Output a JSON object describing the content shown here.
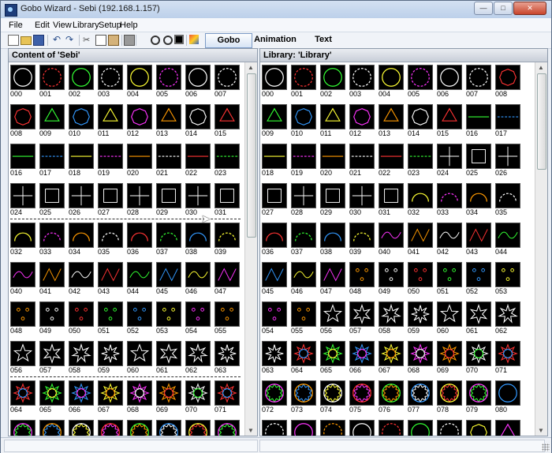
{
  "window": {
    "title": "Gobo Wizard - Sebi (192.168.1.157)",
    "minimize": "—",
    "maximize": "□",
    "close": "✕"
  },
  "menu": [
    "File",
    "Edit",
    "View",
    "Library",
    "Setup",
    "Help"
  ],
  "toolbar_icons": [
    "new-file-icon",
    "open-folder-icon",
    "save-icon",
    "undo-icon",
    "redo-icon",
    "cut-icon",
    "copy-icon",
    "paste-icon",
    "print-icon",
    "grid-icon",
    "zoom-out-icon",
    "zoom-in-icon",
    "fullscreen-icon",
    "color-icon"
  ],
  "tabs": [
    {
      "label": "Gobo",
      "active": true
    },
    {
      "label": "Animation",
      "active": false
    },
    {
      "label": "Text",
      "active": false
    }
  ],
  "left_panel": {
    "title": "Content of 'Sebi'",
    "rows": [
      [
        "000",
        "001",
        "002",
        "003",
        "004",
        "005",
        "006",
        "007"
      ],
      [
        "008",
        "009",
        "010",
        "011",
        "012",
        "013",
        "014",
        "015"
      ],
      [
        "016",
        "017",
        "018",
        "019",
        "020",
        "021",
        "022",
        "023"
      ],
      [
        "024",
        "025",
        "026",
        "027",
        "028",
        "029",
        "030",
        "031"
      ],
      [
        "032",
        "033",
        "034",
        "035",
        "036",
        "037",
        "038",
        "039"
      ],
      [
        "040",
        "041",
        "042",
        "043",
        "044",
        "045",
        "046",
        "047"
      ],
      [
        "048",
        "049",
        "050",
        "051",
        "052",
        "053",
        "054",
        "055"
      ],
      [
        "056",
        "057",
        "058",
        "059",
        "060",
        "061",
        "062",
        "063"
      ],
      [
        "064",
        "065",
        "066",
        "067",
        "068",
        "069",
        "070",
        "071"
      ],
      [
        "",
        "",
        "",
        "",
        "",
        "",
        "",
        ""
      ]
    ],
    "separators_after_rows": [
      3,
      7
    ]
  },
  "right_panel": {
    "title": "Library: 'Library'",
    "rows": [
      [
        "000",
        "001",
        "002",
        "003",
        "004",
        "005",
        "006",
        "007",
        "008"
      ],
      [
        "009",
        "010",
        "011",
        "012",
        "013",
        "014",
        "015",
        "016",
        "017"
      ],
      [
        "018",
        "019",
        "020",
        "021",
        "022",
        "023",
        "024",
        "025",
        "026"
      ],
      [
        "027",
        "028",
        "029",
        "030",
        "031",
        "032",
        "033",
        "034",
        "035"
      ],
      [
        "036",
        "037",
        "038",
        "039",
        "040",
        "041",
        "042",
        "043",
        "044"
      ],
      [
        "045",
        "046",
        "047",
        "048",
        "049",
        "050",
        "051",
        "052",
        "053"
      ],
      [
        "054",
        "055",
        "056",
        "057",
        "058",
        "059",
        "060",
        "061",
        "062"
      ],
      [
        "063",
        "064",
        "065",
        "066",
        "067",
        "068",
        "069",
        "070",
        "071"
      ],
      [
        "072",
        "073",
        "074",
        "075",
        "076",
        "077",
        "078",
        "079",
        "080"
      ],
      [
        "",
        "",
        "",
        "",
        "",
        "",
        "",
        "",
        ""
      ]
    ]
  }
}
